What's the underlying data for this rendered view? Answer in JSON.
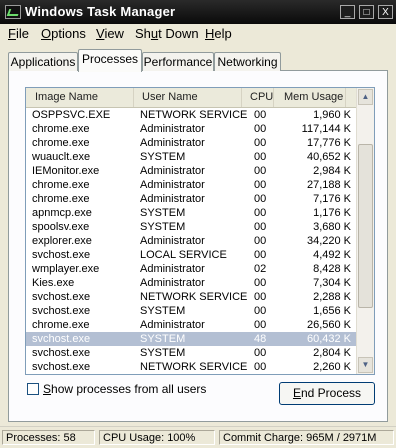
{
  "window": {
    "title": "Windows Task Manager"
  },
  "title_buttons": {
    "minimize": "_",
    "maximize": "□",
    "close": "X"
  },
  "menu": [
    {
      "prefix": "",
      "accel": "F",
      "suffix": "ile"
    },
    {
      "prefix": "",
      "accel": "O",
      "suffix": "ptions"
    },
    {
      "prefix": "",
      "accel": "V",
      "suffix": "iew"
    },
    {
      "prefix": "Sh",
      "accel": "u",
      "suffix": "t Down"
    },
    {
      "prefix": "",
      "accel": "H",
      "suffix": "elp"
    }
  ],
  "tabs": [
    "Applications",
    "Processes",
    "Performance",
    "Networking"
  ],
  "active_tab": "Processes",
  "columns": [
    "Image Name",
    "User Name",
    "CPU",
    "Mem Usage"
  ],
  "processes": [
    {
      "name": "OSPPSVC.EXE",
      "user": "NETWORK SERVICE",
      "cpu": "00",
      "mem": "1,960 K"
    },
    {
      "name": "chrome.exe",
      "user": "Administrator",
      "cpu": "00",
      "mem": "117,144 K"
    },
    {
      "name": "chrome.exe",
      "user": "Administrator",
      "cpu": "00",
      "mem": "17,776 K"
    },
    {
      "name": "wuauclt.exe",
      "user": "SYSTEM",
      "cpu": "00",
      "mem": "40,652 K"
    },
    {
      "name": "IEMonitor.exe",
      "user": "Administrator",
      "cpu": "00",
      "mem": "2,984 K"
    },
    {
      "name": "chrome.exe",
      "user": "Administrator",
      "cpu": "00",
      "mem": "27,188 K"
    },
    {
      "name": "chrome.exe",
      "user": "Administrator",
      "cpu": "00",
      "mem": "7,176 K"
    },
    {
      "name": "apnmcp.exe",
      "user": "SYSTEM",
      "cpu": "00",
      "mem": "1,176 K"
    },
    {
      "name": "spoolsv.exe",
      "user": "SYSTEM",
      "cpu": "00",
      "mem": "3,680 K"
    },
    {
      "name": "explorer.exe",
      "user": "Administrator",
      "cpu": "00",
      "mem": "34,220 K"
    },
    {
      "name": "svchost.exe",
      "user": "LOCAL SERVICE",
      "cpu": "00",
      "mem": "4,492 K"
    },
    {
      "name": "wmplayer.exe",
      "user": "Administrator",
      "cpu": "02",
      "mem": "8,428 K"
    },
    {
      "name": "Kies.exe",
      "user": "Administrator",
      "cpu": "00",
      "mem": "7,304 K"
    },
    {
      "name": "svchost.exe",
      "user": "NETWORK SERVICE",
      "cpu": "00",
      "mem": "2,288 K"
    },
    {
      "name": "svchost.exe",
      "user": "SYSTEM",
      "cpu": "00",
      "mem": "1,656 K"
    },
    {
      "name": "chrome.exe",
      "user": "Administrator",
      "cpu": "00",
      "mem": "26,560 K"
    },
    {
      "name": "svchost.exe",
      "user": "SYSTEM",
      "cpu": "48",
      "mem": "60,432 K",
      "selected": true
    },
    {
      "name": "svchost.exe",
      "user": "SYSTEM",
      "cpu": "00",
      "mem": "2,804 K"
    },
    {
      "name": "svchost.exe",
      "user": "NETWORK SERVICE",
      "cpu": "00",
      "mem": "2,260 K"
    }
  ],
  "show_all": {
    "label_accel": "S",
    "label_rest": "how processes from all users",
    "checked": false
  },
  "end_process": {
    "accel": "E",
    "rest": "nd Process"
  },
  "status": {
    "processes": "Processes: 58",
    "cpu": "CPU Usage: 100%",
    "commit": "Commit Charge: 965M / 2971M"
  },
  "icons": {
    "app": "task-manager-icon",
    "scroll_up": "scroll-up-arrow-icon",
    "scroll_down": "scroll-down-arrow-icon"
  }
}
